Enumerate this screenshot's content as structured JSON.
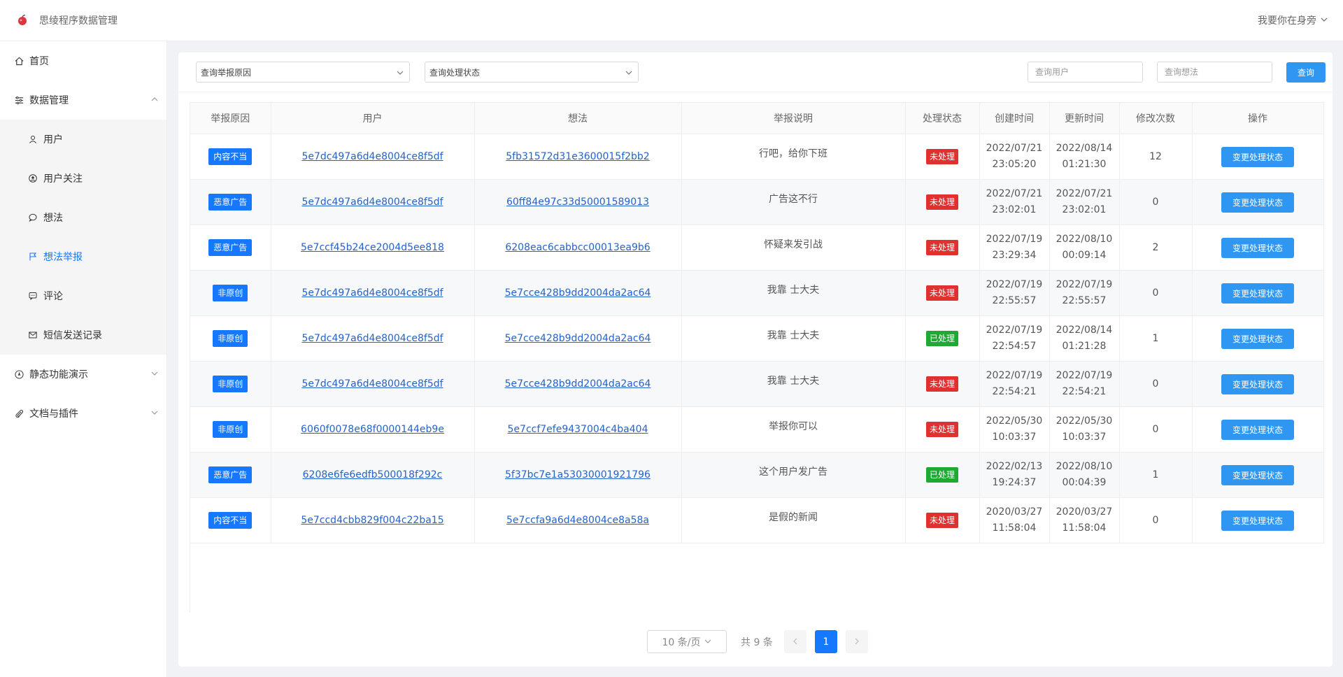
{
  "app": {
    "title": "思绫程序数据管理",
    "user_name": "我要你在身旁"
  },
  "sidebar": {
    "home": "首页",
    "data_mgmt": "数据管理",
    "sub_items": [
      "用户",
      "用户关注",
      "想法",
      "想法举报",
      "评论",
      "短信发送记录"
    ],
    "active_item": "想法举报",
    "static_demo": "静态功能演示",
    "docs": "文档与插件"
  },
  "filters": {
    "reason_placeholder": "查询举报原因",
    "status_placeholder": "查询处理状态",
    "user_placeholder": "查询用户",
    "idea_placeholder": "查询想法",
    "query_label": "查询"
  },
  "table": {
    "headers": [
      "举报原因",
      "用户",
      "想法",
      "举报说明",
      "处理状态",
      "创建时间",
      "更新时间",
      "修改次数",
      "操作"
    ],
    "op_label": "变更处理状态",
    "rows": [
      {
        "reason": "内容不当",
        "user": "5e7dc497a6d4e8004ce8f5df",
        "idea": "5fb31572d31e3600015f2bb2",
        "desc": "行吧，给你下班",
        "status": "未处理",
        "created_date": "2022/07/21",
        "created_time": "23:05:20",
        "updated_date": "2022/08/14",
        "updated_time": "01:21:30",
        "count": "12"
      },
      {
        "reason": "恶意广告",
        "user": "5e7dc497a6d4e8004ce8f5df",
        "idea": "60ff84e97c33d50001589013",
        "desc": "广告这不行",
        "status": "未处理",
        "created_date": "2022/07/21",
        "created_time": "23:02:01",
        "updated_date": "2022/07/21",
        "updated_time": "23:02:01",
        "count": "0"
      },
      {
        "reason": "恶意广告",
        "user": "5e7ccf45b24ce2004d5ee818",
        "idea": "6208eac6cabbcc00013ea9b6",
        "desc": "怀疑来发引战",
        "status": "未处理",
        "created_date": "2022/07/19",
        "created_time": "23:29:34",
        "updated_date": "2022/08/10",
        "updated_time": "00:09:14",
        "count": "2"
      },
      {
        "reason": "非原创",
        "user": "5e7dc497a6d4e8004ce8f5df",
        "idea": "5e7cce428b9dd2004da2ac64",
        "desc": "我靠 士大夫",
        "status": "未处理",
        "created_date": "2022/07/19",
        "created_time": "22:55:57",
        "updated_date": "2022/07/19",
        "updated_time": "22:55:57",
        "count": "0"
      },
      {
        "reason": "非原创",
        "user": "5e7dc497a6d4e8004ce8f5df",
        "idea": "5e7cce428b9dd2004da2ac64",
        "desc": "我靠 士大夫",
        "status": "已处理",
        "created_date": "2022/07/19",
        "created_time": "22:54:57",
        "updated_date": "2022/08/14",
        "updated_time": "01:21:28",
        "count": "1"
      },
      {
        "reason": "非原创",
        "user": "5e7dc497a6d4e8004ce8f5df",
        "idea": "5e7cce428b9dd2004da2ac64",
        "desc": "我靠 士大夫",
        "status": "未处理",
        "created_date": "2022/07/19",
        "created_time": "22:54:21",
        "updated_date": "2022/07/19",
        "updated_time": "22:54:21",
        "count": "0"
      },
      {
        "reason": "非原创",
        "user": "6060f0078e68f0000144eb9e",
        "idea": "5e7ccf7efe9437004c4ba404",
        "desc": "举报你可以",
        "status": "未处理",
        "created_date": "2022/05/30",
        "created_time": "10:03:37",
        "updated_date": "2022/05/30",
        "updated_time": "10:03:37",
        "count": "0"
      },
      {
        "reason": "恶意广告",
        "user": "6208e6fe6edfb500018f292c",
        "idea": "5f37bc7e1a53030001921796",
        "desc": "这个用户发广告",
        "status": "已处理",
        "created_date": "2022/02/13",
        "created_time": "19:24:37",
        "updated_date": "2022/08/10",
        "updated_time": "00:04:39",
        "count": "1"
      },
      {
        "reason": "内容不当",
        "user": "5e7ccd4cbb829f004c22ba15",
        "idea": "5e7ccfa9a6d4e8004ce8a58a",
        "desc": "是假的新闻",
        "status": "未处理",
        "created_date": "2020/03/27",
        "created_time": "11:58:04",
        "updated_date": "2020/03/27",
        "updated_time": "11:58:04",
        "count": "0"
      }
    ]
  },
  "pagination": {
    "page_size": "10 条/页",
    "total": "共 9 条",
    "current": "1"
  },
  "colors": {
    "primary": "#1677ff",
    "button": "#2f96f2",
    "unprocessed": "#e03131",
    "processed": "#1ea932",
    "link": "#2563c9"
  },
  "status_values": {
    "processed": "已处理"
  }
}
